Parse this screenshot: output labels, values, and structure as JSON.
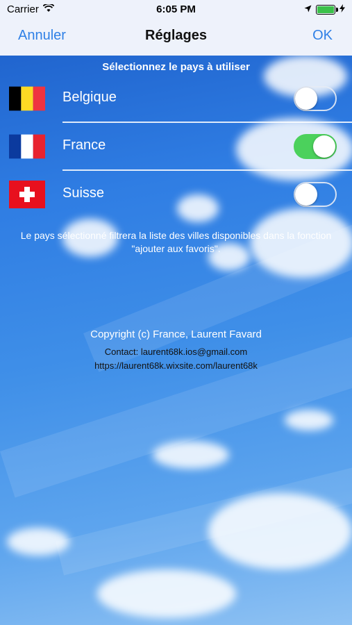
{
  "status_bar": {
    "carrier": "Carrier",
    "time": "6:05 PM"
  },
  "nav": {
    "left_label": "Annuler",
    "title": "Réglages",
    "right_label": "OK"
  },
  "section_title": "Sélectionnez le pays à utiliser",
  "countries": [
    {
      "label": "Belgique",
      "enabled": false
    },
    {
      "label": "France",
      "enabled": true
    },
    {
      "label": "Suisse",
      "enabled": false
    }
  ],
  "note": "Le pays sélectionné filtrera la liste des villes disponibles dans la fonction \"ajouter aux favoris\".",
  "footer": {
    "copyright": "Copyright (c) France, Laurent Favard",
    "contact": "Contact: laurent68k.ios@gmail.com",
    "url": "https://laurent68k.wixsite.com/laurent68k"
  },
  "colors": {
    "accent": "#2f80e6",
    "switch_on": "#4bd15c"
  }
}
